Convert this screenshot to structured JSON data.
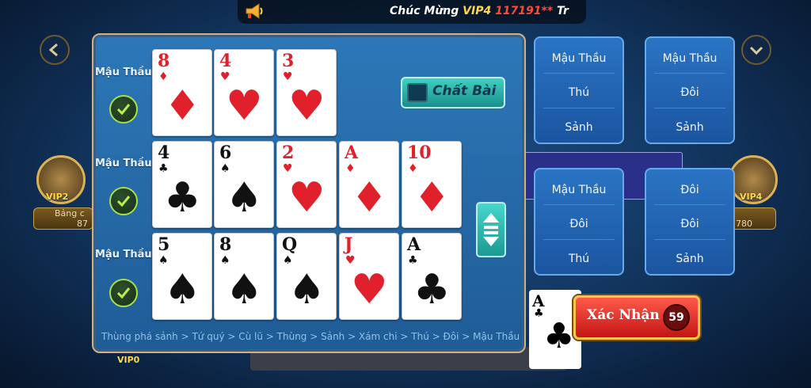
{
  "banner": {
    "prefix": "Chúc Mừng",
    "vip": "VIP4",
    "number": "117191**",
    "suffix": "Tr"
  },
  "background": {
    "left_player": {
      "vip": "VIP2",
      "name": "Bảng c",
      "coins": "87"
    },
    "right_player": {
      "vip": "VIP4",
      "coins": "780"
    },
    "bottom_vip": "VIP0",
    "big_card": {
      "rank": "A",
      "suit": "♣"
    }
  },
  "rows": [
    {
      "label": "Mậu Thầu",
      "cards": [
        {
          "rank": "8",
          "suit": "♦",
          "color": "red"
        },
        {
          "rank": "4",
          "suit": "♥",
          "color": "red"
        },
        {
          "rank": "3",
          "suit": "♥",
          "color": "red"
        }
      ]
    },
    {
      "label": "Mậu Thầu",
      "cards": [
        {
          "rank": "4",
          "suit": "♣",
          "color": "black"
        },
        {
          "rank": "6",
          "suit": "♠",
          "color": "black"
        },
        {
          "rank": "2",
          "suit": "♥",
          "color": "red"
        },
        {
          "rank": "A",
          "suit": "♦",
          "color": "red"
        },
        {
          "rank": "10",
          "suit": "♦",
          "color": "red"
        }
      ]
    },
    {
      "label": "Mậu Thầu",
      "cards": [
        {
          "rank": "5",
          "suit": "♠",
          "color": "black"
        },
        {
          "rank": "8",
          "suit": "♠",
          "color": "black"
        },
        {
          "rank": "Q",
          "suit": "♠",
          "color": "black"
        },
        {
          "rank": "J",
          "suit": "♥",
          "color": "red"
        },
        {
          "rank": "A",
          "suit": "♣",
          "color": "black"
        }
      ]
    }
  ],
  "chat_bai_label": "Chất Bài",
  "legend": "Thùng phá sảnh > Tứ quý > Cù lũ > Thùng > Sảnh > Xám chi > Thú > Đôi > Mậu Thầu",
  "results": [
    {
      "lines": [
        "Mậu Thầu",
        "Thú",
        "Sảnh"
      ]
    },
    {
      "lines": [
        "Mậu Thầu",
        "Đôi",
        "Sảnh"
      ]
    },
    {
      "lines": [
        "Mậu Thầu",
        "Đôi",
        "Thú"
      ]
    },
    {
      "lines": [
        "Đôi",
        "Đôi",
        "Sảnh"
      ]
    }
  ],
  "confirm": {
    "label": "Xác Nhận",
    "timer": "59"
  },
  "colors": {
    "panel": "#2c78b8",
    "confirm": "#d01e1e",
    "teal_button": "#2bb5ad",
    "check": "#a6e04a"
  }
}
